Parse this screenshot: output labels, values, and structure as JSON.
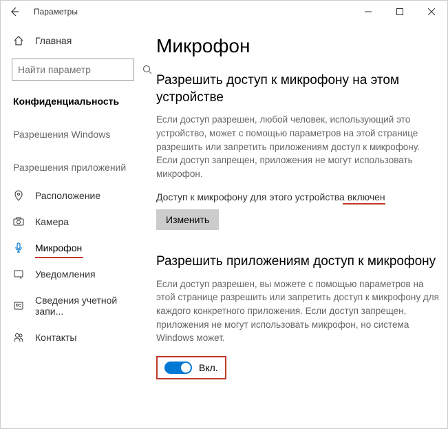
{
  "window": {
    "title": "Параметры"
  },
  "sidebar": {
    "home": "Главная",
    "search_placeholder": "Найти параметр",
    "category": "Конфиденциальность",
    "section_windows": "Разрешения Windows",
    "section_apps": "Разрешения приложений",
    "items": [
      {
        "label": "Расположение"
      },
      {
        "label": "Камера"
      },
      {
        "label": "Микрофон"
      },
      {
        "label": "Уведомления"
      },
      {
        "label": "Сведения учетной запи..."
      },
      {
        "label": "Контакты"
      }
    ]
  },
  "main": {
    "heading": "Микрофон",
    "section1_title": "Разрешить доступ к микрофону на этом устройстве",
    "section1_desc": "Если доступ разрешен, любой человек, использующий это устройство, может с помощью параметров на этой странице разрешить или запретить приложениям доступ к микрофону. Если доступ запрещен, приложения не могут использовать микрофон.",
    "status_prefix": "Доступ к микрофону для этого устройства ",
    "status_value": "включен",
    "change_btn": "Изменить",
    "section2_title": "Разрешить приложениям доступ к микрофону",
    "section2_desc": "Если доступ разрешен, вы можете с помощью параметров на этой странице разрешить или запретить доступ к микрофону для каждого конкретного приложения. Если доступ запрещен, приложения не могут использовать микрофон, но система Windows может.",
    "toggle_label": "Вкл."
  }
}
